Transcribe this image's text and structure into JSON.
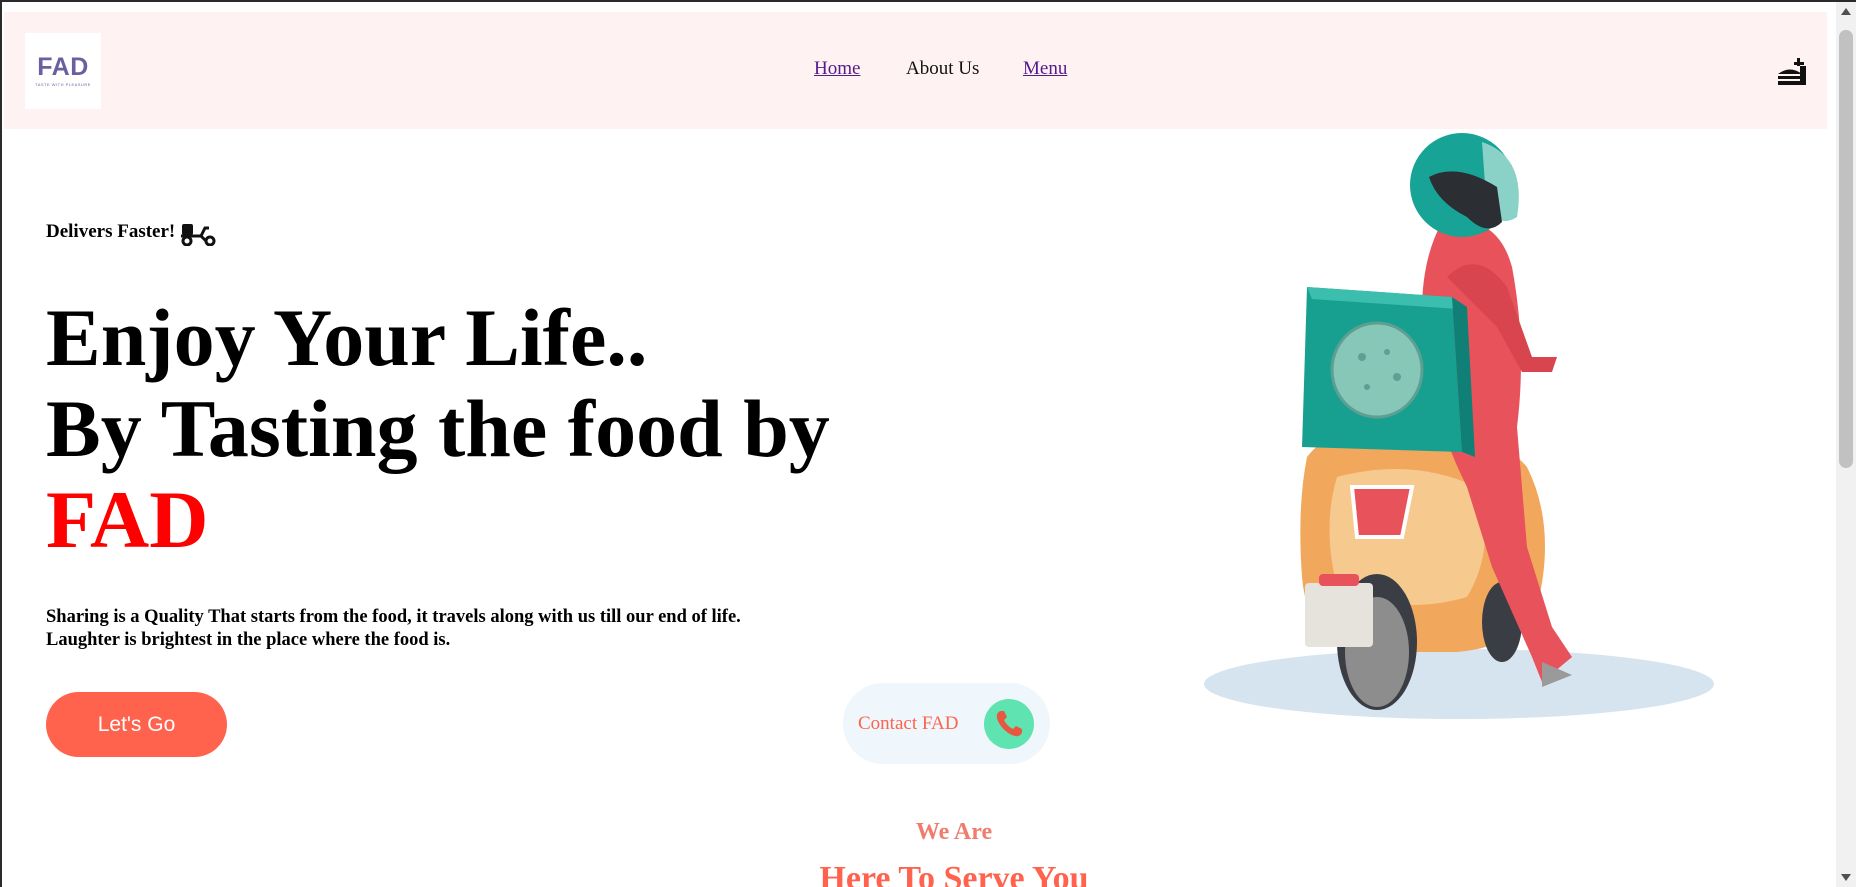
{
  "header": {
    "logo_text": "FAD",
    "logo_tagline": "taste with pleasure",
    "nav": {
      "home": "Home",
      "about": "About Us",
      "menu": "Menu"
    },
    "cart_icon": "food-tray-icon"
  },
  "hero": {
    "tagline": "Delivers Faster!",
    "tagline_icon": "scooter-icon",
    "headline_line1": "Enjoy Your Life..",
    "headline_line2": "By Tasting the food by",
    "headline_brand": "FAD",
    "description_line1": "Sharing is a Quality That starts from the food, it travels along with us till our end of life.",
    "description_line2": "Laughter is brightest in the place where the food is.",
    "cta_label": "Let's Go",
    "contact_label": "Contact FAD",
    "contact_icon": "phone-icon",
    "illustration": "delivery-rider-illustration"
  },
  "section": {
    "kicker": "We Are",
    "title": "Here To Serve You"
  },
  "colors": {
    "accent": "#ff634d",
    "brand_red": "#ff0000",
    "navbar_bg": "#fef2f2",
    "contact_bg": "#f0f7fc",
    "phone_circle": "#5fe3b1",
    "logo_purple": "#6b5fa0"
  }
}
